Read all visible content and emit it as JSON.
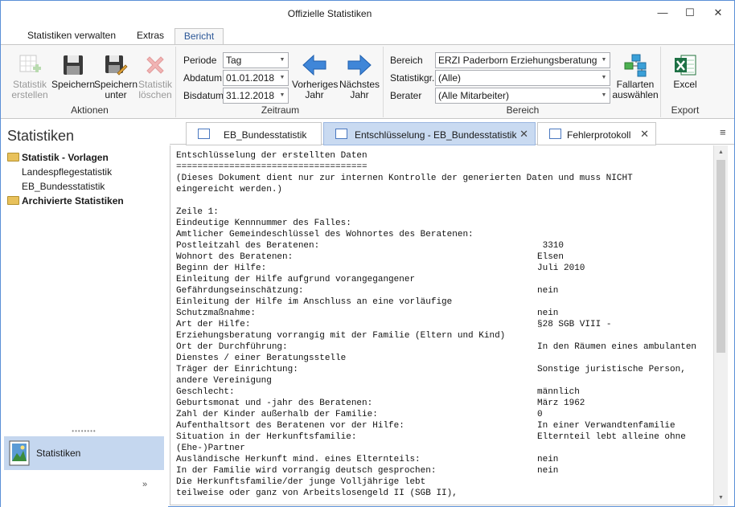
{
  "window": {
    "title": "Offizielle Statistiken",
    "controls": [
      "—",
      "☐",
      "✕"
    ]
  },
  "menu_tabs": [
    {
      "label": "Statistiken verwalten",
      "active": false
    },
    {
      "label": "Extras",
      "active": false
    },
    {
      "label": "Bericht",
      "active": true
    }
  ],
  "ribbon": {
    "aktionen": {
      "group_label": "Aktionen",
      "buttons": [
        {
          "label": "Statistik erstellen",
          "enabled": false,
          "icon": "create-statistic-icon"
        },
        {
          "label": "Speichern",
          "enabled": true,
          "icon": "save-icon"
        },
        {
          "label": "Speichern unter",
          "enabled": true,
          "icon": "save-as-icon"
        },
        {
          "label": "Statistik löschen",
          "enabled": false,
          "icon": "delete-icon"
        }
      ]
    },
    "zeitraum": {
      "group_label": "Zeitraum",
      "periode_label": "Periode",
      "periode_value": "Tag",
      "abdatum_label": "Abdatum",
      "abdatum_value": "01.01.2018",
      "bisdatum_label": "Bisdatum",
      "bisdatum_value": "31.12.2018",
      "prev_label": "Vorheriges Jahr",
      "next_label": "Nächstes Jahr"
    },
    "bereich": {
      "group_label": "Bereich",
      "bereich_label": "Bereich",
      "bereich_value": "ERZI Paderborn Erziehungsberatung (E",
      "statistikgr_label": "Statistikgr.",
      "statistikgr_value": "(Alle)",
      "berater_label": "Berater",
      "berater_value": "(Alle Mitarbeiter)",
      "fallarten_label": "Fallarten auswählen"
    },
    "export": {
      "group_label": "Export",
      "excel_label": "Excel"
    }
  },
  "sidebar": {
    "title": "Statistiken",
    "tree": [
      {
        "label": "Statistik - Vorlagen",
        "type": "folder"
      },
      {
        "label": "Landespflegestatistik",
        "type": "item"
      },
      {
        "label": "EB_Bundesstatistik",
        "type": "item"
      },
      {
        "label": "Archivierte Statistiken",
        "type": "folder"
      }
    ],
    "splitter": "••••••••",
    "nav_button": "Statistiken",
    "more": "»"
  },
  "doc_tabs": [
    {
      "label": "EB_Bundesstatistik",
      "active": false
    },
    {
      "label": "Entschlüsselung - EB_Bundesstatistik",
      "active": true
    },
    {
      "label": "Fehlerprotokoll",
      "active": false
    }
  ],
  "doc_menu": "≡",
  "document": {
    "lines": [
      {
        "text": "Entschlüsselung der erstellten Daten",
        "value": ""
      },
      {
        "text": "====================================",
        "value": ""
      },
      {
        "text": "(Dieses Dokument dient nur zur internen Kontrolle der generierten Daten und muss NICHT",
        "value": ""
      },
      {
        "text": "eingereicht werden.)",
        "value": ""
      },
      {
        "text": "",
        "value": ""
      },
      {
        "text": "Zeile 1:",
        "value": ""
      },
      {
        "text": "Eindeutige Kennnummer des Falles:",
        "value": ""
      },
      {
        "text": "Amtlicher Gemeindeschlüssel des Wohnortes des Beratenen:",
        "value": ""
      },
      {
        "text": "Postleitzahl des Beratenen:",
        "value": " 3310"
      },
      {
        "text": "Wohnort des Beratenen:",
        "value": "Elsen"
      },
      {
        "text": "Beginn der Hilfe:",
        "value": "Juli 2010"
      },
      {
        "text": "Einleitung der Hilfe aufgrund vorangegangener",
        "value": ""
      },
      {
        "text": "Gefährdungseinschätzung:",
        "value": "nein"
      },
      {
        "text": "Einleitung der Hilfe im Anschluss an eine vorläufige",
        "value": ""
      },
      {
        "text": "Schutzmaßnahme:",
        "value": "nein"
      },
      {
        "text": "Art der Hilfe:",
        "value": "§28 SGB VIII -"
      },
      {
        "text": "Erziehungsberatung vorrangig mit der Familie (Eltern und Kind)",
        "value": ""
      },
      {
        "text": "Ort der Durchführung:",
        "value": "In den Räumen eines ambulanten"
      },
      {
        "text": "Dienstes / einer Beratungsstelle",
        "value": ""
      },
      {
        "text": "Träger der Einrichtung:",
        "value": "Sonstige juristische Person,"
      },
      {
        "text": "andere Vereinigung",
        "value": ""
      },
      {
        "text": "Geschlecht:",
        "value": "männlich"
      },
      {
        "text": "Geburtsmonat und -jahr des Beratenen:",
        "value": "März 1962"
      },
      {
        "text": "Zahl der Kinder außerhalb der Familie:",
        "value": "0"
      },
      {
        "text": "Aufenthaltsort des Beratenen vor der Hilfe:",
        "value": "In einer Verwandtenfamilie"
      },
      {
        "text": "Situation in der Herkunftsfamilie:",
        "value": "Elternteil lebt alleine ohne"
      },
      {
        "text": "(Ehe-)Partner",
        "value": ""
      },
      {
        "text": "Ausländische Herkunft mind. eines Elternteils:",
        "value": "nein"
      },
      {
        "text": "In der Familie wird vorrangig deutsch gesprochen:",
        "value": "nein"
      },
      {
        "text": "Die Herkunftsfamilie/der junge Volljährige lebt",
        "value": ""
      },
      {
        "text": "teilweise oder ganz von Arbeitslosengeld II (SGB II),",
        "value": ""
      }
    ]
  },
  "colors": {
    "accent": "#2b5797",
    "active_tab": "#c9daf1",
    "nav_selected": "#c5d7ef",
    "window_border": "#5b8fd6"
  }
}
